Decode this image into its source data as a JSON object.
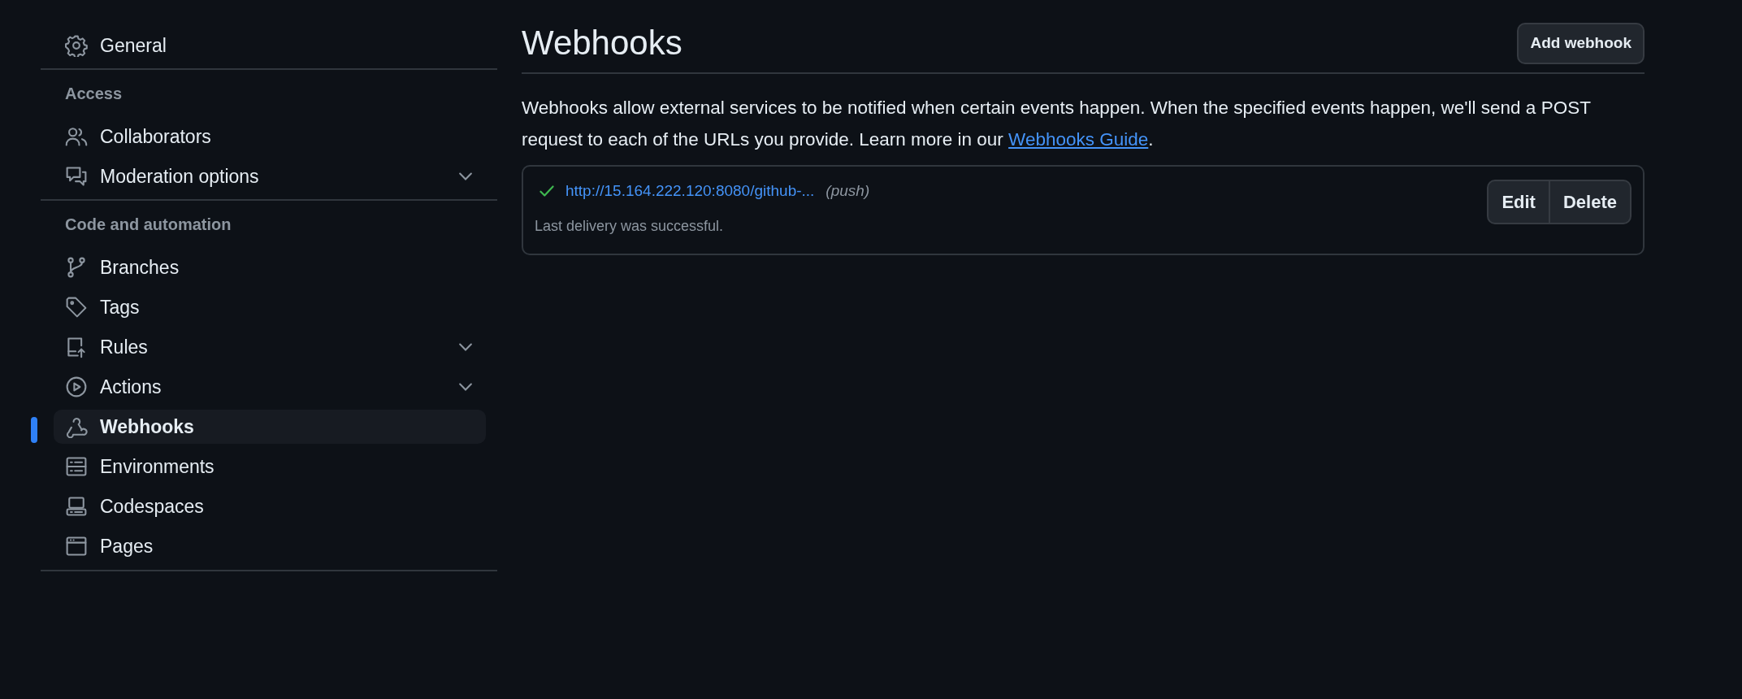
{
  "sidebar": {
    "sections": [
      {
        "items": [
          {
            "label": "General",
            "selected": false
          }
        ]
      },
      {
        "heading": "Access",
        "items": [
          {
            "label": "Collaborators",
            "selected": false
          },
          {
            "label": "Moderation options",
            "selected": false,
            "expanded": false
          }
        ]
      },
      {
        "heading": "Code and automation",
        "items": [
          {
            "label": "Branches",
            "selected": false
          },
          {
            "label": "Tags",
            "selected": false
          },
          {
            "label": "Rules",
            "selected": false,
            "expanded": false
          },
          {
            "label": "Actions",
            "selected": false,
            "expanded": false
          },
          {
            "label": "Webhooks",
            "selected": true
          },
          {
            "label": "Environments",
            "selected": false
          },
          {
            "label": "Codespaces",
            "selected": false
          },
          {
            "label": "Pages",
            "selected": false
          }
        ]
      }
    ]
  },
  "page": {
    "title": "Webhooks",
    "add_button": "Add webhook",
    "description": "Webhooks allow external services to be notified when certain events happen. When the specified events happen, we'll send a POST request to each of the URLs you provide. Learn more in our ",
    "description_link": "Webhooks Guide",
    "description_end": ".",
    "webhooks": [
      {
        "url": "http://15.164.222.120:8080/github-...",
        "events": "(push)",
        "status": "Last delivery was successful.",
        "buttons": [
          "Edit",
          "Delete"
        ]
      }
    ]
  }
}
